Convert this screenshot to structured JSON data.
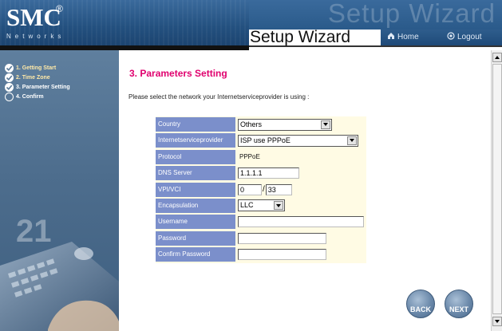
{
  "header": {
    "logo": "SMC",
    "logo_reg": "®",
    "logo_sub": "Networks",
    "ghost_title": "Setup Wizard",
    "title": "Setup Wizard",
    "nav": {
      "home": "Home",
      "logout": "Logout"
    },
    "colors": {
      "band": "#2a5a8a",
      "title": "#111111"
    }
  },
  "sidebar": {
    "steps": [
      {
        "label": "1. Getting Start",
        "status": "done"
      },
      {
        "label": "2. Time Zone",
        "status": "done"
      },
      {
        "label": "3. Parameter Setting",
        "status": "current"
      },
      {
        "label": "4. Confirm",
        "status": "pending"
      }
    ]
  },
  "main": {
    "title": "3. Parameters Setting",
    "intro": "Please select the network your Internetserviceprovider is using :",
    "title_color": "#e0006e",
    "label_color": "#7b8fcb",
    "form": {
      "country": {
        "label": "Country",
        "value": "Others"
      },
      "isp": {
        "label": "Internetserviceprovider",
        "value": "ISP use PPPoE"
      },
      "protocol": {
        "label": "Protocol",
        "value": "PPPoE"
      },
      "dns": {
        "label": "DNS Server",
        "value": "1.1.1.1"
      },
      "vpivci": {
        "label": "VPI/VCI",
        "vpi": "0",
        "separator": "/",
        "vci": "33"
      },
      "encapsulation": {
        "label": "Encapsulation",
        "value": "LLC"
      },
      "username": {
        "label": "Username",
        "value": ""
      },
      "password": {
        "label": "Password",
        "value": ""
      },
      "confirm_password": {
        "label": "Confirm Password",
        "value": ""
      }
    },
    "buttons": {
      "back": "BACK",
      "next": "NEXT"
    }
  }
}
